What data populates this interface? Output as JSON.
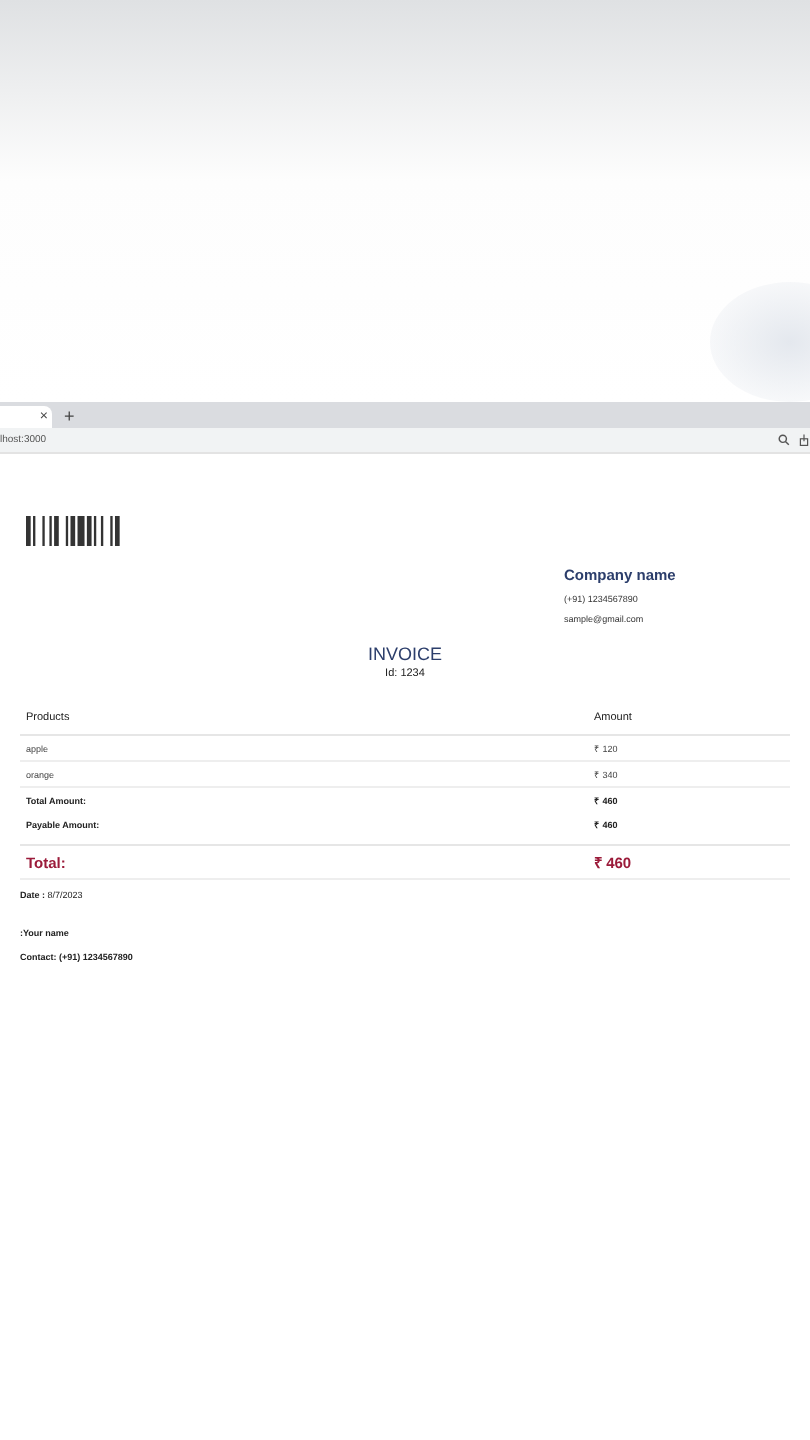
{
  "browser": {
    "tab_close": "×",
    "new_tab": "+",
    "address": "lhost:3000"
  },
  "invoice": {
    "company": {
      "name": "Company name",
      "phone": "(+91) 1234567890",
      "email": "sample@gmail.com"
    },
    "title": "INVOICE",
    "id": "Id: 1234",
    "table": {
      "columns": [
        "Products",
        "Amount"
      ],
      "rows": [
        {
          "kind": "item",
          "product": "apple",
          "amount": "₹ 120"
        },
        {
          "kind": "item",
          "product": "orange",
          "amount": "₹ 340"
        },
        {
          "kind": "summary",
          "product": "Total Amount:",
          "amount": "₹ 460"
        },
        {
          "kind": "summary",
          "product": "Payable Amount:",
          "amount": "₹ 460"
        },
        {
          "kind": "total",
          "product": "Total:",
          "amount": "₹ 460"
        }
      ]
    },
    "date": "**Date :** 8/7/2023",
    "signature": ":Your name",
    "contact": "Contact: (+91) 1234567890"
  }
}
